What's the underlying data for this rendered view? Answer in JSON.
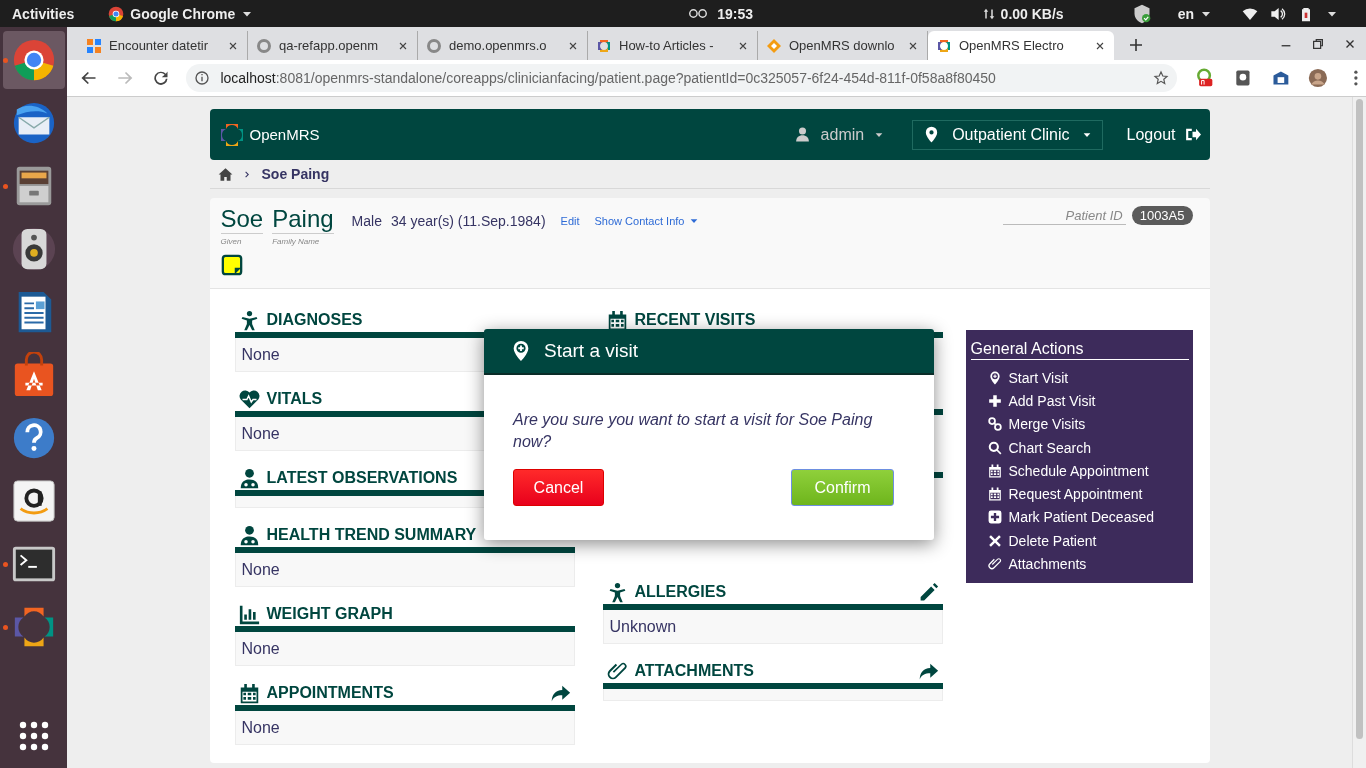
{
  "topbar": {
    "activities": "Activities",
    "app_menu": "Google Chrome",
    "clock": "19:53",
    "network_speed": "0.00 KB/s",
    "language": "en"
  },
  "dock": {
    "apps": [
      {
        "kind": "browser",
        "running": true,
        "selected": true
      },
      {
        "kind": "mail",
        "running": false,
        "selected": false
      },
      {
        "kind": "files",
        "running": true,
        "selected": false
      },
      {
        "kind": "speaker",
        "running": false,
        "selected": false
      },
      {
        "kind": "writer",
        "running": false,
        "selected": false
      },
      {
        "kind": "store",
        "running": false,
        "selected": false
      },
      {
        "kind": "help",
        "running": false,
        "selected": false
      },
      {
        "kind": "shop",
        "running": false,
        "selected": false
      },
      {
        "kind": "terminal",
        "running": true,
        "selected": false
      },
      {
        "kind": "ring",
        "running": true,
        "selected": false
      }
    ]
  },
  "browser": {
    "tabs": [
      {
        "title": "Encounter datetir",
        "selected": false
      },
      {
        "title": "qa-refapp.openm",
        "selected": false
      },
      {
        "title": "demo.openmrs.o",
        "selected": false
      },
      {
        "title": "How-to Articles - ",
        "selected": false
      },
      {
        "title": "OpenMRS downlo",
        "selected": false
      },
      {
        "title": "OpenMRS Electro",
        "selected": true
      }
    ],
    "url": {
      "host": "localhost",
      "path": ":8081/openmrs-standalone/coreapps/clinicianfacing/patient.page?patientId=0c325057-6f24-454d-811f-0f58a8f80450"
    }
  },
  "header": {
    "brand": "OpenMRS",
    "user": "admin",
    "location": "Outpatient Clinic",
    "logout": "Logout"
  },
  "breadcrumb": {
    "current": "Soe Paing"
  },
  "patient": {
    "given_name": "Soe",
    "family_name": "Paing",
    "given_label": "Given",
    "family_label": "Family Name",
    "gender": "Male",
    "age": "34 year(s) (11.Sep.1984)",
    "edit_link": "Edit",
    "contact_link": "Show Contact Info",
    "id_label": "Patient ID",
    "id": "1003A5"
  },
  "widgets": {
    "left": [
      {
        "title": "DIAGNOSES",
        "content": "None"
      },
      {
        "title": "VITALS",
        "content": "None"
      },
      {
        "title": "LATEST OBSERVATIONS"
      },
      {
        "title": "HEALTH TREND SUMMARY",
        "content": "None"
      },
      {
        "title": "WEIGHT GRAPH",
        "content": "None"
      },
      {
        "title": "APPOINTMENTS",
        "content": "None"
      }
    ],
    "right": [
      {
        "title": "RECENT VISITS"
      },
      {
        "title": "ALLERGIES",
        "content": "Unknown"
      },
      {
        "title": "ATTACHMENTS"
      }
    ]
  },
  "general_actions": {
    "title": "General Actions",
    "items": [
      "Start Visit",
      "Add Past Visit",
      "Merge Visits",
      "Chart Search",
      "Schedule Appointment",
      "Request Appointment",
      "Mark Patient Deceased",
      "Delete Patient",
      "Attachments"
    ]
  },
  "dialog": {
    "title": "Start a visit",
    "message": "Are you sure you want to start a visit for Soe Paing now?",
    "cancel": "Cancel",
    "confirm": "Confirm"
  }
}
